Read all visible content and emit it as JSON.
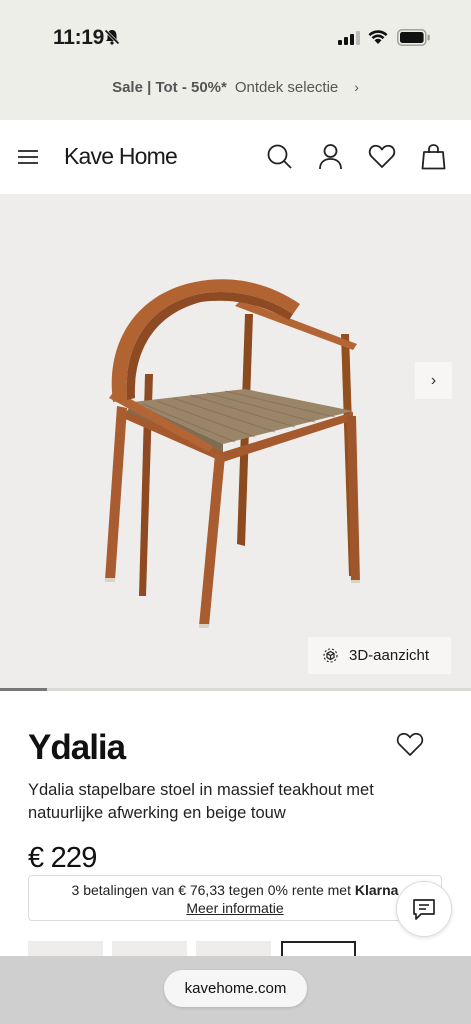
{
  "status_bar": {
    "time": "11:19",
    "icons": [
      "bell-slash-icon",
      "signal-icon",
      "wifi-icon",
      "battery-icon"
    ]
  },
  "promo": {
    "sale_text": "Sale | Tot - 50%*",
    "link_text": "Ontdek selectie",
    "chevron": "›"
  },
  "header": {
    "logo": "Kave Home",
    "icons": [
      "menu-icon",
      "search-icon",
      "account-icon",
      "wishlist-icon",
      "cart-icon"
    ]
  },
  "gallery": {
    "next_arrow": "›",
    "view_3d_label": "3D-aanzicht",
    "progress_fraction": 0.1
  },
  "product": {
    "name": "Ydalia",
    "description": "Ydalia stapelbare stoel in massief teakhout met natuurlijke afwerking en beige touw",
    "price": "€ 229"
  },
  "klarna": {
    "text": "3 betalingen van € 76,33 tegen 0% rente met",
    "brand": "Klarna",
    "more_info": "Meer informatie"
  },
  "variants": {
    "count": 4,
    "selected_index": 3
  },
  "browser": {
    "url": "kavehome.com"
  },
  "colors": {
    "background_top": "#eeeee9",
    "gallery_bg": "#efedeb",
    "teak": "#a55a2e",
    "rope": "#9a8568"
  }
}
